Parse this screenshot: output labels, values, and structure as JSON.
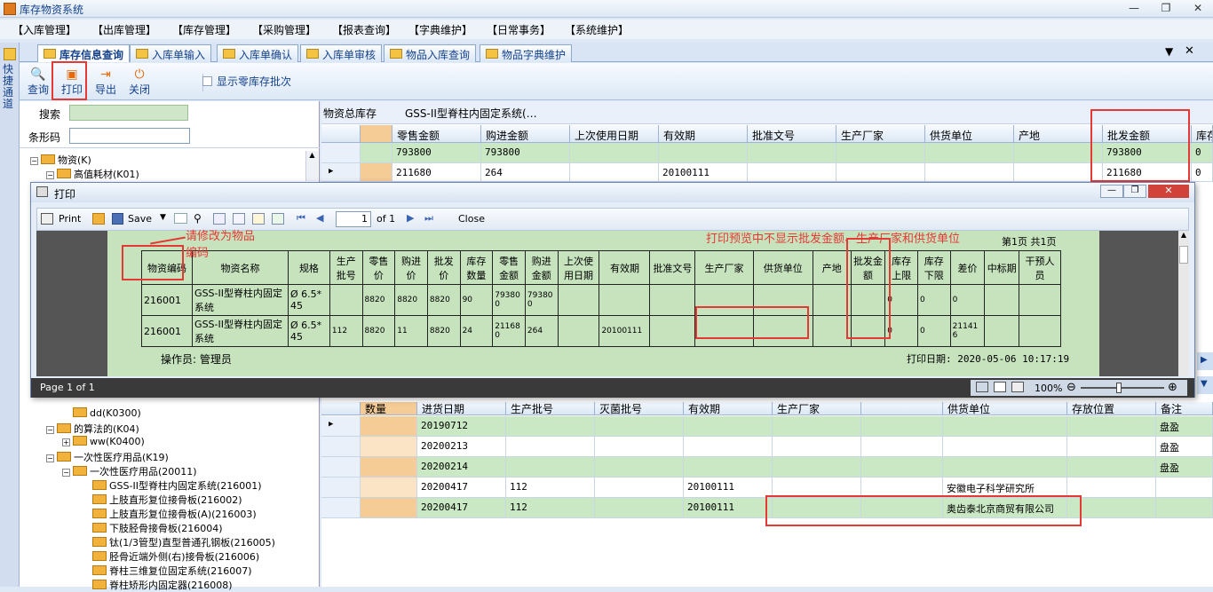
{
  "app": {
    "title": "库存物资系统"
  },
  "menu": [
    "【入库管理】",
    "【出库管理】",
    "【库存管理】",
    "【采购管理】",
    "【报表查询】",
    "【字典维护】",
    "【日常事务】",
    "【系统维护】"
  ],
  "sidebar_label": "快捷通道",
  "tabs": [
    "库存信息查询",
    "入库单输入",
    "入库单确认",
    "入库单审核",
    "物品入库查询",
    "物品字典维护"
  ],
  "toolbar": {
    "query": "查询",
    "print": "打印",
    "export": "导出",
    "close": "关闭",
    "show_zero": "显示零库存批次"
  },
  "left": {
    "search_label": "搜索",
    "barcode_label": "条形码"
  },
  "tree_top": [
    {
      "label": "物资(K)"
    },
    {
      "label": "高值耗材(K01)"
    }
  ],
  "tree_bottom": [
    {
      "label": "dd(K0300)"
    },
    {
      "label": "的算法的(K04)"
    },
    {
      "label": "ww(K0400)"
    },
    {
      "label": "一次性医疗用品(K19)"
    },
    {
      "label": "一次性医疗用品(20011)"
    },
    {
      "label": "GSS-II型脊柱内固定系统(216001)"
    },
    {
      "label": "上肢直形复位接骨板(216002)"
    },
    {
      "label": "上肢直形复位接骨板(A)(216003)"
    },
    {
      "label": "下肢胫骨接骨板(216004)"
    },
    {
      "label": "钛(1/3管型)直型普通孔钢板(216005)"
    },
    {
      "label": "胫骨近端外侧(右)接骨板(216006)"
    },
    {
      "label": "脊柱三维复位固定系统(216007)"
    },
    {
      "label": "脊柱矫形内固定器(216008)"
    }
  ],
  "summary": {
    "label": "物资总库存",
    "item": "GSS-II型脊柱内固定系统(…",
    "headers": [
      "零售金额",
      "购进金额",
      "上次使用日期",
      "有效期",
      "批准文号",
      "生产厂家",
      "供货单位",
      "产地",
      "批发金额",
      "库存"
    ],
    "rows": [
      [
        "793800",
        "793800",
        "",
        "",
        "",
        "",
        "",
        "",
        "793800",
        "0"
      ],
      [
        "211680",
        "264",
        "",
        "20100111",
        "",
        "",
        "",
        "",
        "211680",
        "0"
      ]
    ]
  },
  "detail": {
    "headers": [
      "数量",
      "进货日期",
      "生产批号",
      "灭菌批号",
      "有效期",
      "生产厂家",
      "",
      "供货单位",
      "存放位置",
      "备注"
    ],
    "rows": [
      [
        "",
        "20190712",
        "",
        "",
        "",
        "",
        "",
        "",
        "",
        "盘盈"
      ],
      [
        "",
        "20200213",
        "",
        "",
        "",
        "",
        "",
        "",
        "",
        "盘盈"
      ],
      [
        "",
        "20200214",
        "",
        "",
        "",
        "",
        "",
        "",
        "",
        "盘盈"
      ],
      [
        "",
        "20200417",
        "112",
        "",
        "20100111",
        "",
        "",
        "安徽电子科学研究所",
        "",
        ""
      ],
      [
        "",
        "20200417",
        "112",
        "",
        "20100111",
        "",
        "",
        "奥齿泰北京商贸有限公司",
        "",
        ""
      ]
    ]
  },
  "dialog": {
    "title": "打印",
    "tools": {
      "print": "Print",
      "save": "Save",
      "page_value": "1",
      "of": "of 1",
      "close": "Close"
    },
    "page_info": "第1页  共1页",
    "headers": [
      "物资编码",
      "物资名称",
      "规格",
      "生产批号",
      "零售价",
      "购进价",
      "批发价",
      "库存数量",
      "零售金额",
      "购进金额",
      "上次使用日期",
      "有效期",
      "批准文号",
      "生产厂家",
      "供货单位",
      "产地",
      "批发金额",
      "库存上限",
      "库存下限",
      "差价",
      "中标期",
      "干预人员"
    ],
    "rows": [
      [
        "216001",
        "GSS-II型脊柱内固定系统",
        "Ø 6.5*45",
        "",
        "8820",
        "8820",
        "8820",
        "90",
        "793800",
        "793800",
        "",
        "",
        "",
        "",
        "",
        "",
        "",
        "0",
        "0",
        "0",
        "",
        ""
      ],
      [
        "216001",
        "GSS-II型脊柱内固定系统",
        "Ø 6.5*45",
        "112",
        "8820",
        "11",
        "8820",
        "24",
        "211680",
        "264",
        "",
        "20100111",
        "",
        "",
        "",
        "",
        "",
        "0",
        "0",
        "211416",
        "",
        ""
      ]
    ],
    "operator": "操作员: 管理员",
    "print_date": "打印日期: 2020-05-06 10:17:19",
    "status": "Page 1 of 1",
    "zoom": "100%"
  },
  "annotations": {
    "rename": "请修改为物品编码",
    "note": "打印预览中不显示批发金额、生产厂家和供货单位"
  },
  "colors": {
    "accent": "#15428b",
    "grid_green": "#c9e8c3",
    "annotation_red": "#e53935"
  }
}
